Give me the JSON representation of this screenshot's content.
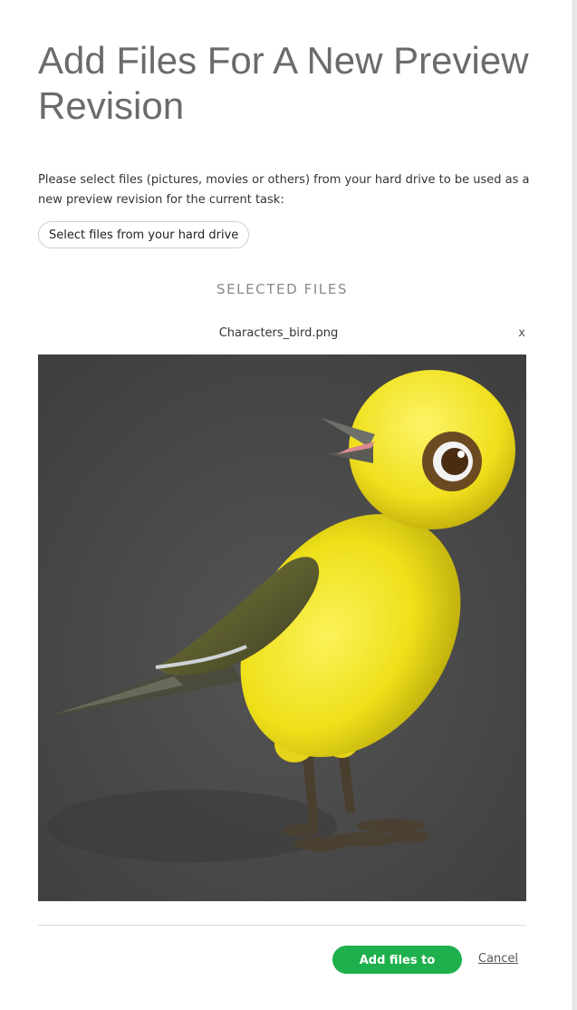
{
  "dialog": {
    "title": "Add Files For A New Preview Revision",
    "instructions": "Please select files (pictures, movies or others) from your hard drive to be used as a new preview revision for the current task:",
    "select_button_label": "Select files from your hard drive",
    "selected_files_heading": "SELECTED FILES",
    "files": [
      {
        "name": "Characters_bird.png",
        "remove_label": "x"
      }
    ],
    "publish_button_label": "Add files to publish",
    "cancel_label": "Cancel"
  },
  "colors": {
    "accent": "#1eb04c",
    "preview_background": "#474747",
    "bird_yellow": "#f2e41c"
  },
  "icons": {
    "remove": "close-x-glyph"
  }
}
